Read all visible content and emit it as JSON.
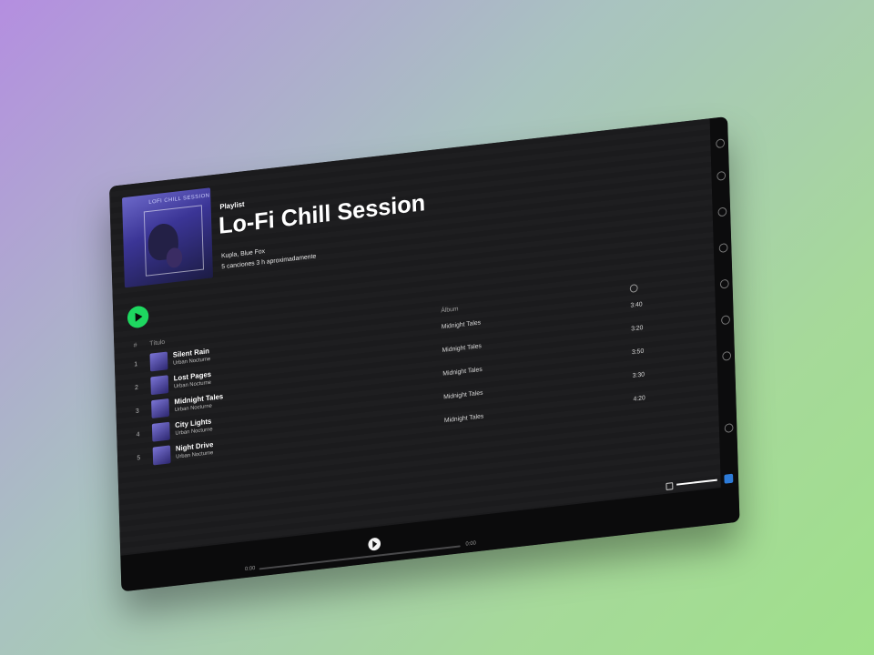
{
  "playlist": {
    "kind": "Playlist",
    "title": "Lo-Fi Chill Session",
    "owners": "Kupla, Blue Fox",
    "stats": "5 canciones 3 h aproximadamente",
    "cover_text": "LOFI CHILL SESSION"
  },
  "columns": {
    "number": "#",
    "title": "Título",
    "album": "Álbum"
  },
  "tracks": [
    {
      "num": "1",
      "title": "Silent Rain",
      "artist": "Urban Nocturne",
      "album": "Midnight Tales",
      "duration": "3:40"
    },
    {
      "num": "2",
      "title": "Lost Pages",
      "artist": "Urban Nocturne",
      "album": "Midnight Tales",
      "duration": "3:20"
    },
    {
      "num": "3",
      "title": "Midnight Tales",
      "artist": "Urban Nocturne",
      "album": "Midnight Tales",
      "duration": "3:50"
    },
    {
      "num": "4",
      "title": "City Lights",
      "artist": "Urban Nocturne",
      "album": "Midnight Tales",
      "duration": "3:30"
    },
    {
      "num": "5",
      "title": "Night Drive",
      "artist": "Urban Nocturne",
      "album": "Midnight Tales",
      "duration": "4:20"
    }
  ],
  "player": {
    "elapsed": "0:00",
    "total": "0:00",
    "progress": 0,
    "volume": 1.0
  },
  "colors": {
    "accent": "#1ed760",
    "background": "#161618",
    "bar": "#0b0b0c"
  }
}
